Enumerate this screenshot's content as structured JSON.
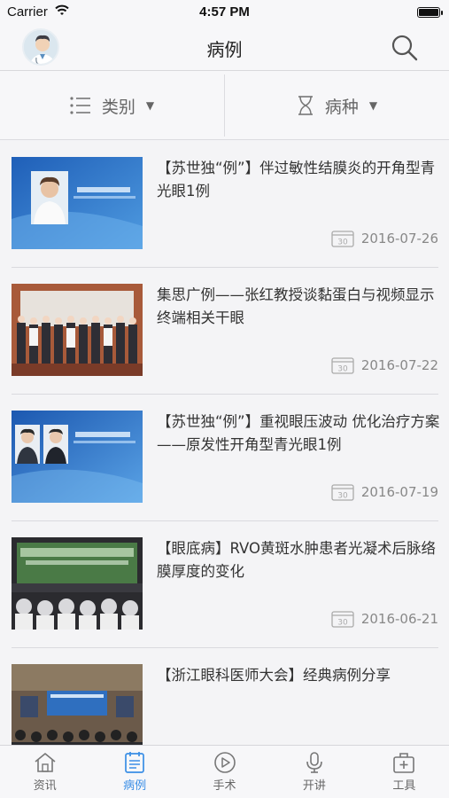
{
  "status_bar": {
    "carrier": "Carrier",
    "time": "4:57 PM"
  },
  "nav": {
    "title": "病例",
    "search_icon": "search-icon"
  },
  "filters": [
    {
      "label": "类别",
      "icon": "list-icon"
    },
    {
      "label": "病种",
      "icon": "hourglass-icon"
    }
  ],
  "cases": [
    {
      "title": "【苏世独“例”】伴过敏性结膜炎的开角型青光眼1例",
      "date": "2016-07-26",
      "thumb": "video-screenshot"
    },
    {
      "title": "集思广例——张红教授谈黏蛋白与视频显示终端相关干眼",
      "date": "2016-07-22",
      "thumb": "group-photo"
    },
    {
      "title": "【苏世独“例”】重视眼压波动 优化治疗方案 ——原发性开角型青光眼1例",
      "date": "2016-07-19",
      "thumb": "video-screenshot-two-doctors"
    },
    {
      "title": "【眼底病】RVO黄斑水肿患者光凝术后脉络膜厚度的变化",
      "date": "2016-06-21",
      "thumb": "conference-stage"
    },
    {
      "title": "【浙江眼科医师大会】经典病例分享",
      "date": "",
      "thumb": "conference-hall"
    }
  ],
  "tabs": [
    {
      "label": "资讯",
      "icon": "home-icon",
      "active": false
    },
    {
      "label": "病例",
      "icon": "notebook-icon",
      "active": true
    },
    {
      "label": "手术",
      "icon": "play-icon",
      "active": false
    },
    {
      "label": "开讲",
      "icon": "microphone-icon",
      "active": false
    },
    {
      "label": "工具",
      "icon": "toolbox-icon",
      "active": false
    }
  ],
  "colors": {
    "accent": "#3a8ee6",
    "background": "#f4f4f6"
  }
}
